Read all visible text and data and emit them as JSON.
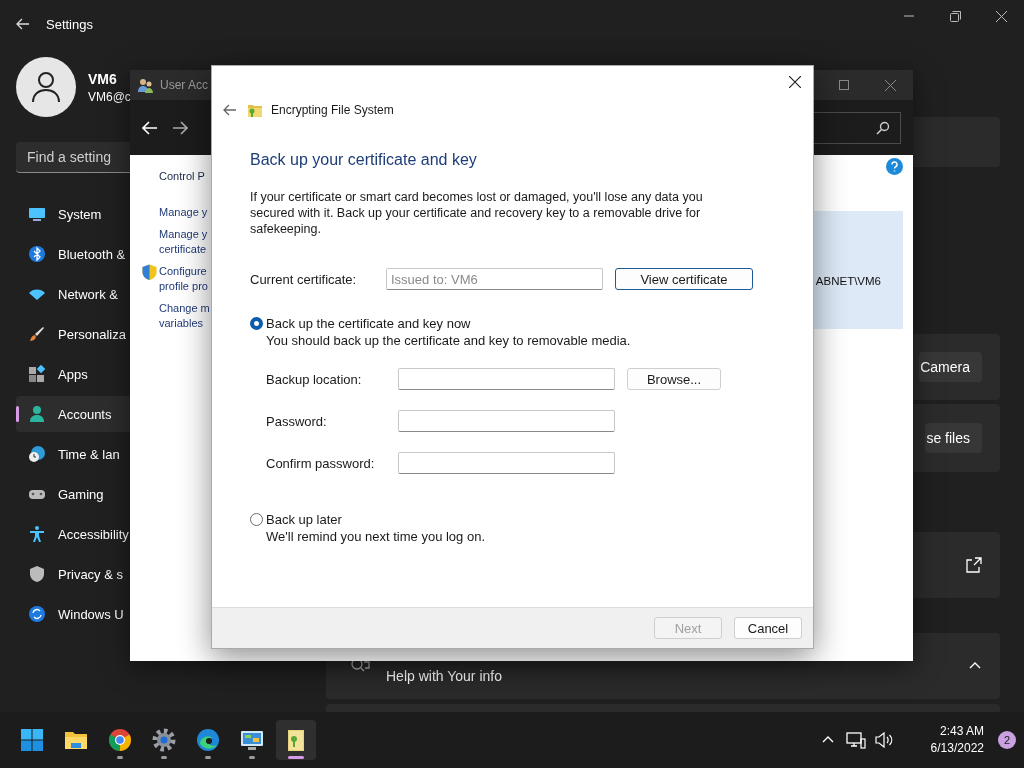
{
  "settings": {
    "title": "Settings",
    "user": {
      "name": "VM6",
      "email": "VM6@c"
    },
    "search": {
      "placeholder": "Find a setting"
    },
    "nav": [
      {
        "label": "System",
        "kind": "system",
        "selected": false
      },
      {
        "label": "Bluetooth &",
        "kind": "bluetooth",
        "selected": false
      },
      {
        "label": "Network &",
        "kind": "wifi",
        "selected": false
      },
      {
        "label": "Personaliza",
        "kind": "brush",
        "selected": false
      },
      {
        "label": "Apps",
        "kind": "apps",
        "selected": false
      },
      {
        "label": "Accounts",
        "kind": "person",
        "selected": true
      },
      {
        "label": "Time & lan",
        "kind": "clock",
        "selected": false
      },
      {
        "label": "Gaming",
        "kind": "gamepad",
        "selected": false
      },
      {
        "label": "Accessibility",
        "kind": "accessibility",
        "selected": false
      },
      {
        "label": "Privacy & s",
        "kind": "shield",
        "selected": false
      },
      {
        "label": "Windows U",
        "kind": "update",
        "selected": false
      }
    ],
    "cards": [
      {
        "kind": "plain"
      },
      {
        "kind": "button",
        "button": "Camera"
      },
      {
        "kind": "button",
        "button": "se files"
      },
      {
        "kind": "link"
      },
      {
        "kind": "expander",
        "title": "Help with Your info",
        "expanded": true
      },
      {
        "kind": "plain"
      }
    ]
  },
  "control_panel": {
    "title": "User Acc",
    "links": [
      {
        "kind": "crumb",
        "lines": [
          "Control P"
        ]
      },
      {
        "kind": "task",
        "lines": [
          "Manage y"
        ]
      },
      {
        "kind": "task",
        "lines": [
          "Manage y",
          "certificate"
        ]
      },
      {
        "kind": "admin",
        "lines": [
          "Configure",
          "profile pro"
        ]
      },
      {
        "kind": "task",
        "lines": [
          "Change m",
          "variables"
        ]
      }
    ],
    "account_text": "ABNET\\VM6"
  },
  "dialog": {
    "title": "Encrypting File System",
    "heading": "Back up your certificate and key",
    "intro": "If your certificate or smart card becomes lost or damaged, you'll lose any data you secured with it. Back up your certificate and recovery key to a removable drive for safekeeping.",
    "current": {
      "label": "Current certificate:",
      "value": "Issued to: VM6",
      "disabled": true,
      "button": "View certificate"
    },
    "options": [
      {
        "label": "Back up the certificate and key now",
        "note": "You should back up the certificate and key to removable media.",
        "selected": true,
        "fields": [
          {
            "label": "Backup location:",
            "button": "Browse..."
          },
          {
            "label": "Password:"
          },
          {
            "label": "Confirm password:"
          }
        ]
      },
      {
        "label": "Back up later",
        "note": "We'll remind you next time you log on.",
        "selected": false
      }
    ],
    "buttons": [
      {
        "label": "Next",
        "disabled": true
      },
      {
        "label": "Cancel",
        "disabled": false
      }
    ]
  },
  "taskbar": {
    "apps": [
      {
        "kind": "start",
        "running": false,
        "selected": false
      },
      {
        "kind": "folder",
        "running": false,
        "selected": false
      },
      {
        "kind": "chrome",
        "running": true,
        "selected": false
      },
      {
        "kind": "gear",
        "running": true,
        "selected": false
      },
      {
        "kind": "edge",
        "running": true,
        "selected": false
      },
      {
        "kind": "control-panel",
        "running": true,
        "selected": false
      },
      {
        "kind": "efs",
        "running": true,
        "selected": true
      }
    ],
    "time": "2:43 AM",
    "date": "6/13/2022",
    "badge": "2"
  }
}
